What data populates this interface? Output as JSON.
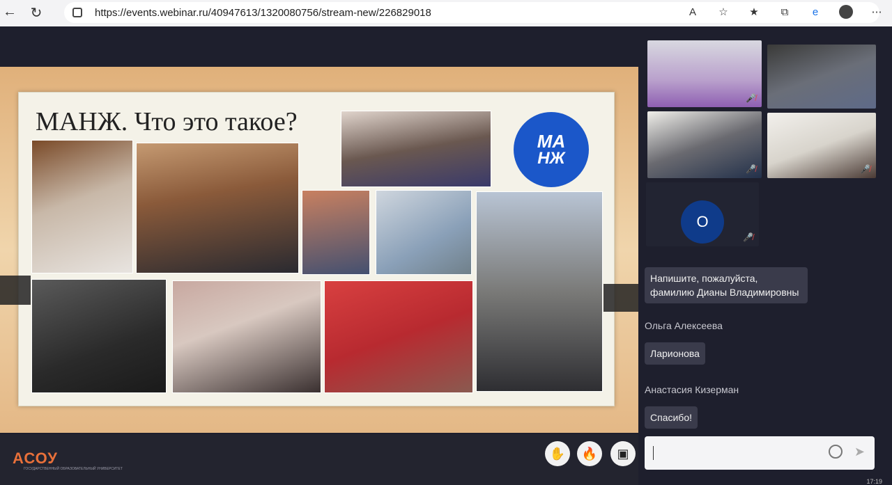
{
  "browser": {
    "url": "https://events.webinar.ru/40947613/1320080756/stream-new/226829018",
    "icons": [
      "read-aloud-icon",
      "favorite-add-icon",
      "favorites-icon",
      "collections-icon",
      "edge-icon",
      "profile-icon",
      "more-icon"
    ]
  },
  "slide": {
    "title": "МАНЖ. Что это такое?",
    "logo_line1": "МА",
    "logo_line2": "НЖ"
  },
  "participants": [
    {
      "name": "",
      "muted": true
    },
    {
      "name": "",
      "muted": false
    },
    {
      "name": "",
      "muted": true
    },
    {
      "name": "",
      "muted": true
    },
    {
      "initial": "О",
      "muted": true
    }
  ],
  "chat": {
    "messages": [
      {
        "sender": "",
        "text_line1": "Напишите, пожалуйста,",
        "text_line2": "фамилию Дианы Владимировны"
      },
      {
        "sender": "Ольга Алексеева",
        "text": "Ларионова"
      },
      {
        "sender": "Анастасия Кизерман",
        "text": "Спасибо!"
      }
    ],
    "input_placeholder": ""
  },
  "branding": {
    "logo": "АСОУ",
    "logo_sub": "ГОСУДАРСТВЕННЫЙ ОБРАЗОВАТЕЛЬНЫЙ УНИВЕРСИТЕТ"
  },
  "controls": {
    "hand_icon": "raise-hand-icon",
    "fire_icon": "reaction-icon",
    "screen_icon": "screen-layout-icon"
  },
  "clock": "17:19"
}
